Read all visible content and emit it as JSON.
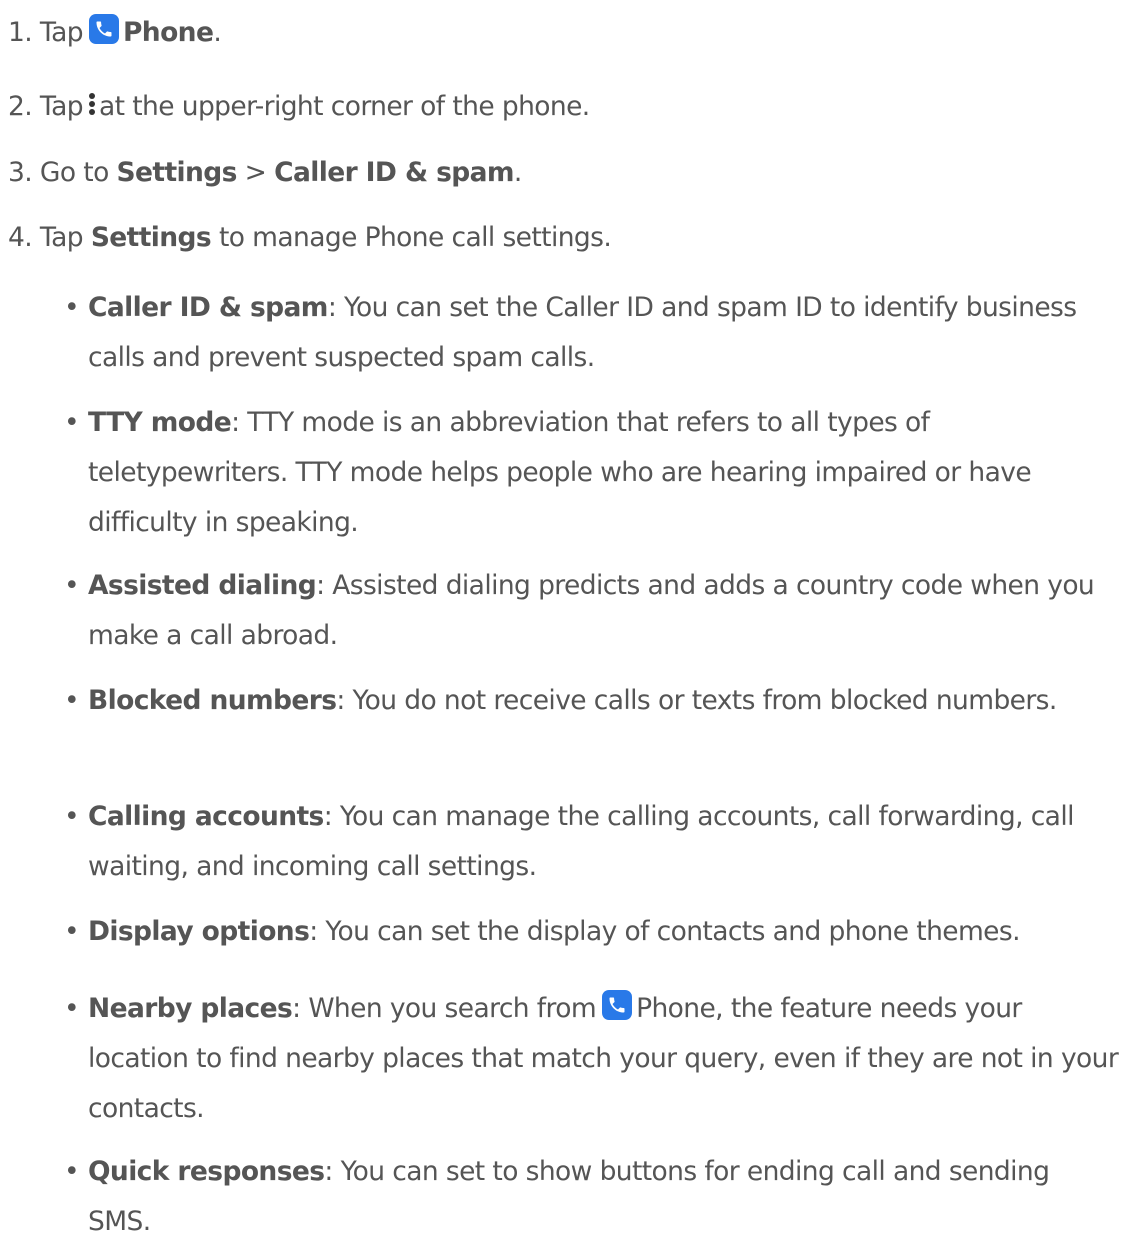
{
  "steps": [
    {
      "num": "1.",
      "pre": "Tap",
      "icon": "phone-icon",
      "bold": "Phone",
      "post": "."
    },
    {
      "num": "2.",
      "pre": "Tap",
      "icon": "more-vertical-icon",
      "post": "at the upper-right corner of the phone."
    },
    {
      "num": "3.",
      "pre": "Go to",
      "bold1": "Settings",
      "sep": ">",
      "bold2": "Caller ID & spam",
      "post": "."
    },
    {
      "num": "4.",
      "pre": "Tap",
      "bold": "Settings",
      "post": "to manage Phone call settings."
    }
  ],
  "bullet_glyph": "•",
  "bullets": [
    {
      "term": "Caller ID & spam",
      "desc": ": You can set the Caller ID and spam ID to identify business calls and prevent suspected spam calls."
    },
    {
      "term": "TTY mode",
      "desc": ": TTY mode is an abbreviation that refers to all types of teletypewriters. TTY mode helps people who are hearing impaired or have difficulty in speaking."
    },
    {
      "term": "Assisted dialing",
      "desc": ": Assisted dialing predicts and adds a country code when you make a call abroad."
    },
    {
      "term": "Blocked numbers",
      "desc": ": You do not receive calls or texts from blocked numbers."
    },
    {
      "term": "Calling accounts",
      "desc": ": You can manage the calling accounts, call forwarding, call waiting, and incoming call settings."
    },
    {
      "term": "Display options",
      "desc": ": You can set the display of contacts and phone themes."
    },
    {
      "term": "Nearby places",
      "desc_pre": ": When you search from",
      "icon": "phone-icon",
      "desc_post": "Phone, the feature needs your location to find nearby places that match your query, even if they are not in your contacts."
    },
    {
      "term": "Quick responses",
      "desc": ": You can set to show buttons for ending call and sending SMS."
    }
  ],
  "colors": {
    "text": "#555555",
    "icon_bg": "#2979e8",
    "icon_fg": "#ffffff"
  }
}
